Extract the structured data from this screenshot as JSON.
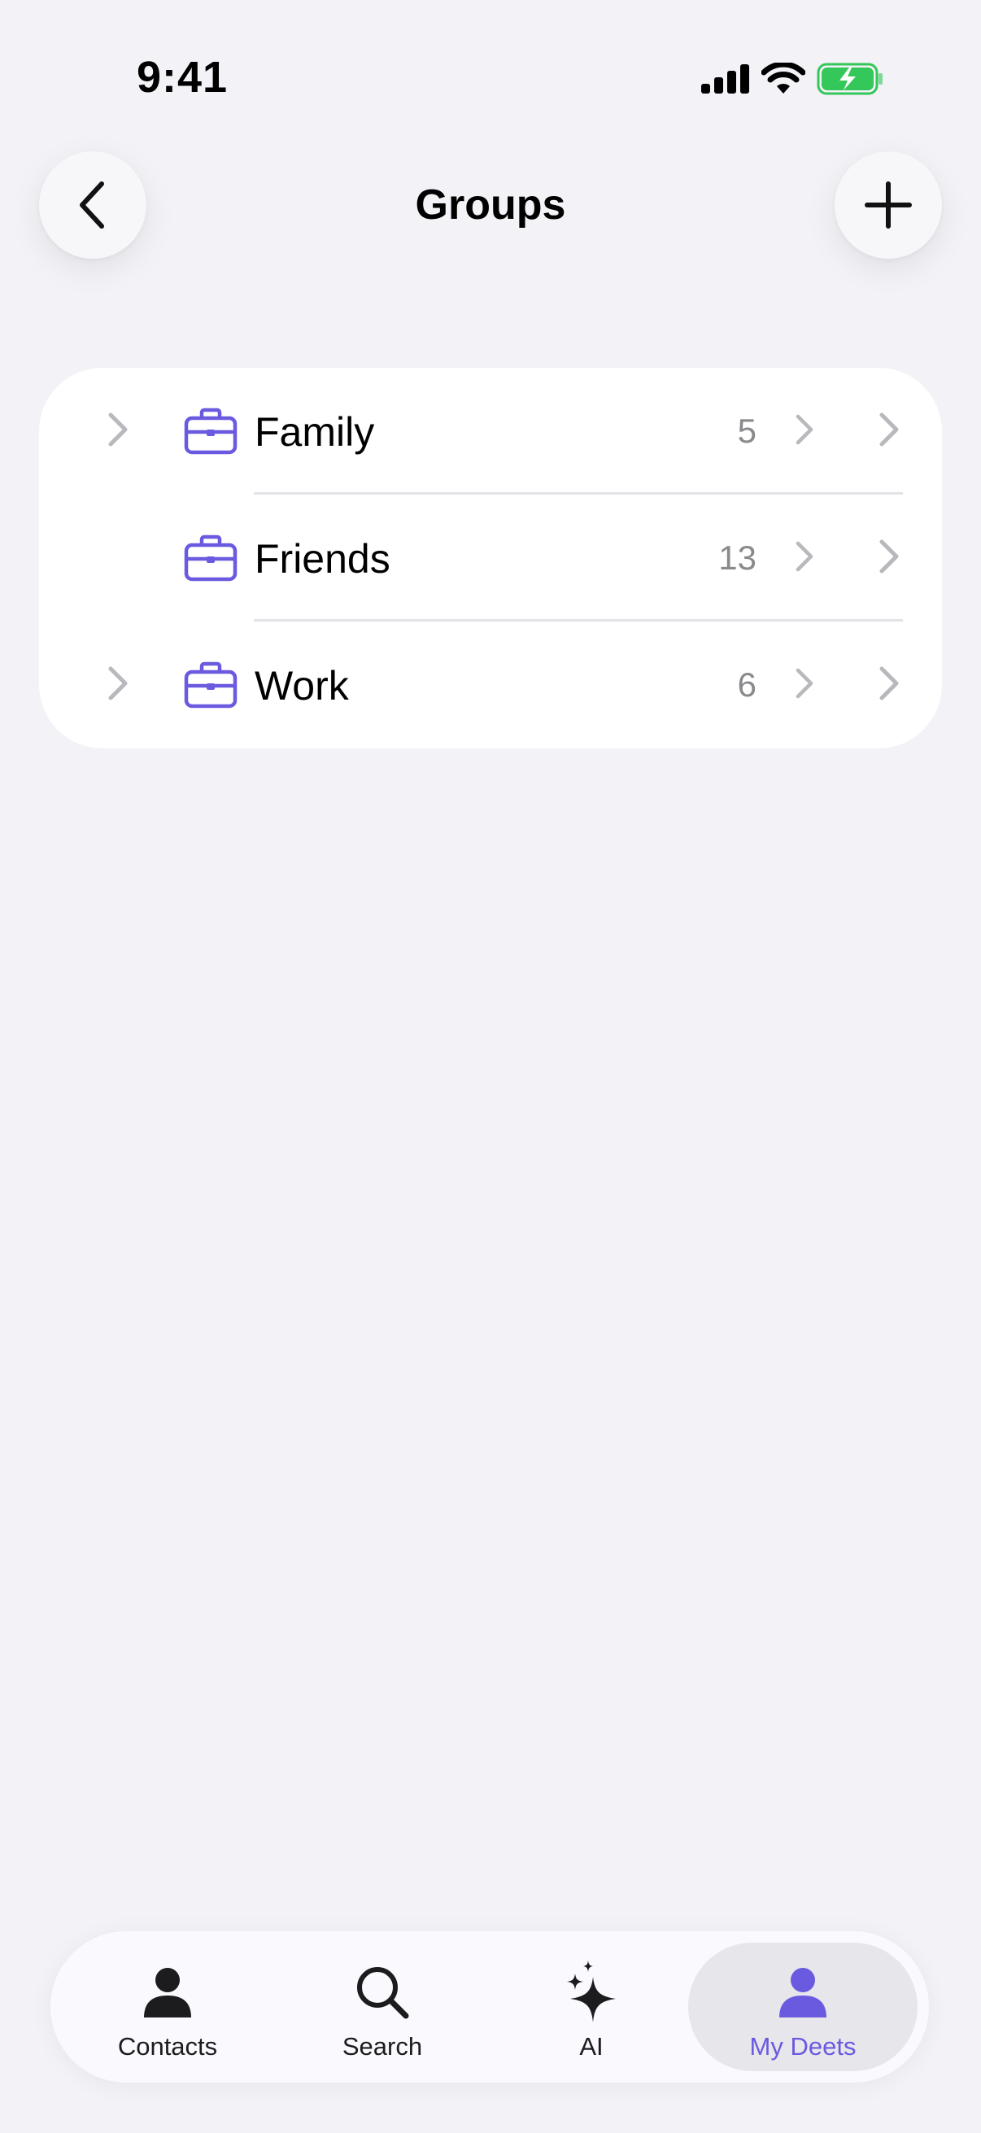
{
  "status_bar": {
    "time": "9:41",
    "icons": [
      "cellular-signal-icon",
      "wifi-icon",
      "battery-charging-icon"
    ]
  },
  "header": {
    "title": "Groups",
    "back_icon": "chevron-left-icon",
    "add_icon": "plus-icon"
  },
  "groups": [
    {
      "name": "Family",
      "count": "5",
      "expandable": true
    },
    {
      "name": "Friends",
      "count": "13",
      "expandable": false
    },
    {
      "name": "Work",
      "count": "6",
      "expandable": true
    }
  ],
  "tab_bar": {
    "tabs": [
      {
        "label": "Contacts",
        "icon": "person-icon",
        "active": false
      },
      {
        "label": "Search",
        "icon": "magnifying-glass-icon",
        "active": false
      },
      {
        "label": "AI",
        "icon": "sparkles-icon",
        "active": false
      },
      {
        "label": "My Deets",
        "icon": "person-icon",
        "active": true
      }
    ]
  },
  "colors": {
    "accent": "#6a5ae0",
    "background": "#f2f2f7",
    "battery_green": "#34c759",
    "secondary_text": "#8a8a8e",
    "chevron": "#b8b8bd"
  }
}
